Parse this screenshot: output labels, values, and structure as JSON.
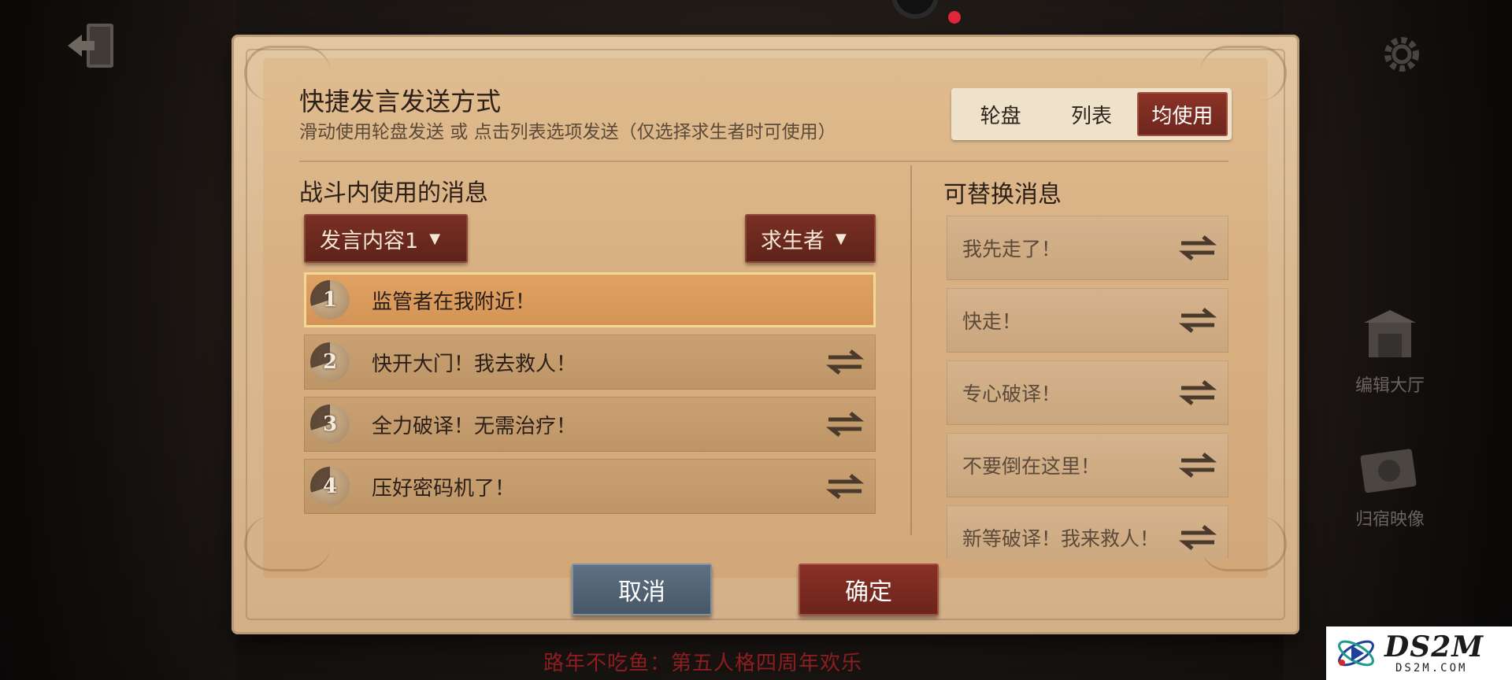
{
  "dialog": {
    "title": "快捷发言发送方式",
    "subtitle": "滑动使用轮盘发送 或 点击列表选项发送（仅选择求生者时可使用）",
    "send_modes": [
      {
        "label": "轮盘",
        "active": false
      },
      {
        "label": "列表",
        "active": false
      },
      {
        "label": "均使用",
        "active": true
      }
    ]
  },
  "battle": {
    "section_title": "战斗内使用的消息",
    "content_dropdown": "发言内容1",
    "role_dropdown": "求生者",
    "messages": [
      {
        "num": "1",
        "text": "监管者在我附近！",
        "selected": true
      },
      {
        "num": "2",
        "text": "快开大门！我去救人！",
        "selected": false
      },
      {
        "num": "3",
        "text": "全力破译！无需治疗！",
        "selected": false
      },
      {
        "num": "4",
        "text": "压好密码机了！",
        "selected": false
      }
    ]
  },
  "replace": {
    "section_title": "可替换消息",
    "messages": [
      {
        "text": "我先走了！"
      },
      {
        "text": "快走！"
      },
      {
        "text": "专心破译！"
      },
      {
        "text": "不要倒在这里！"
      },
      {
        "text": "新等破译！我来救人！"
      }
    ]
  },
  "buttons": {
    "cancel": "取消",
    "confirm": "确定"
  },
  "side_menu": [
    {
      "label": "编辑大厅",
      "icon": "hall-icon"
    },
    {
      "label": "归宿映像",
      "icon": "camera-icon"
    }
  ],
  "caption": "路年不吃鱼：第五人格四周年欢乐",
  "watermark": {
    "title": "DS2M",
    "url": "DS2M.COM"
  },
  "colors": {
    "accent_red": "#6c261c",
    "cancel_blue": "#465665",
    "selected_row": "#d49355"
  }
}
